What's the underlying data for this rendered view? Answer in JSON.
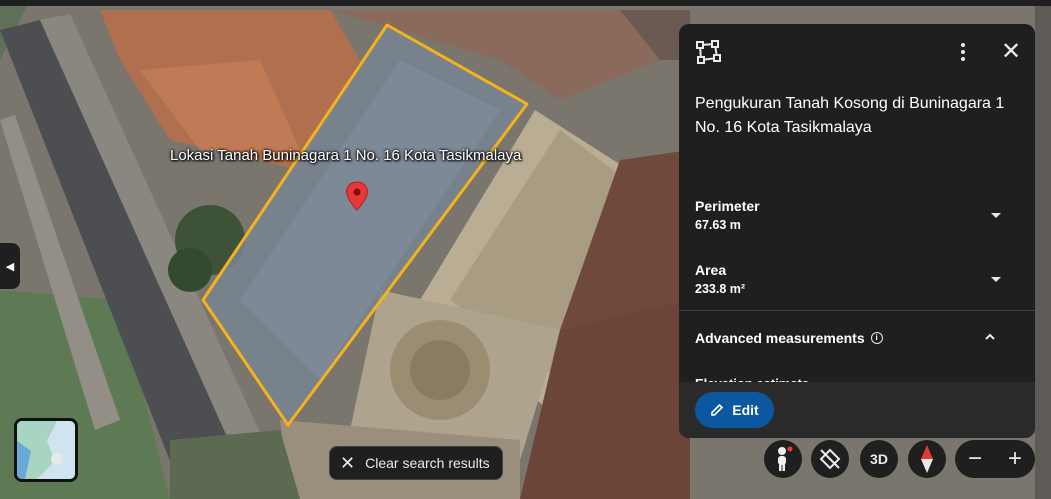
{
  "map": {
    "place_label": "Lokasi Tanah Buninagara 1 No. 16 Kota Tasikmalaya",
    "polygon_color": "#f5b21b"
  },
  "panel": {
    "title": "Pengukuran Tanah Kosong di Buninagara 1 No. 16 Kota Tasikmalaya",
    "perimeter_label": "Perimeter",
    "perimeter_value": "67.63 m",
    "area_label": "Area",
    "area_value": "233.8 m²",
    "advanced_label": "Advanced measurements",
    "elevation_label": "Elevation estimate",
    "edit_label": "Edit"
  },
  "chip": {
    "clear_label": "Clear search results"
  },
  "controls": {
    "three_d_label": "3D",
    "zoom_out": "−",
    "zoom_in": "+"
  },
  "icons": {
    "measure": "measure-polygon-icon",
    "more": "more-vert-icon",
    "close": "close-icon",
    "pegman": "pegman-icon",
    "tilt": "tilt-off-icon",
    "compass": "compass-icon"
  },
  "colors": {
    "panel_bg": "#1f1f1f",
    "edit_button": "#0b57a0",
    "pin": "#e53935"
  }
}
